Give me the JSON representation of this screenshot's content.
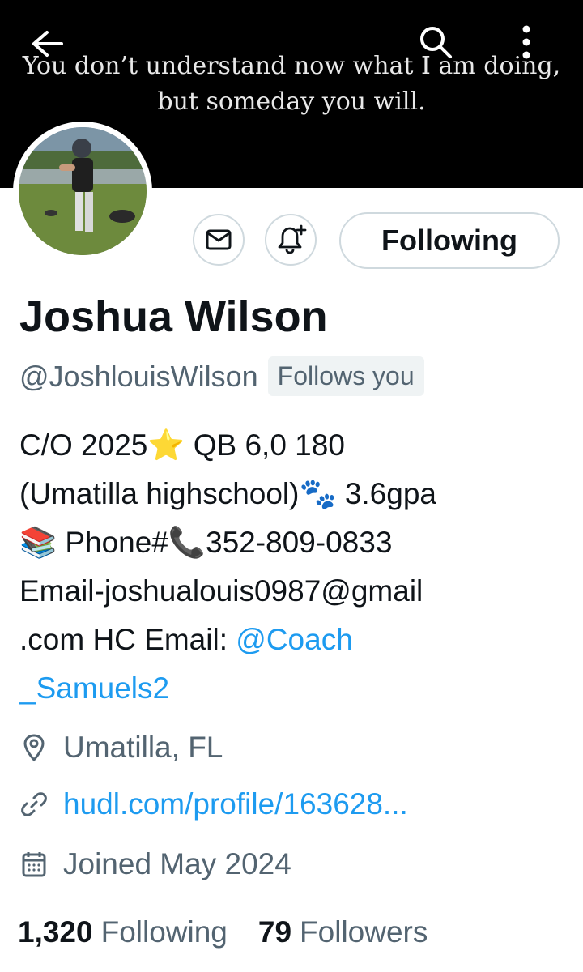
{
  "banner": {
    "quote_line1": "You don’t understand now what I am doing,",
    "quote_line2": "but someday you will."
  },
  "toolbar": {
    "back_icon": "arrow-left-icon",
    "search_icon": "search-icon",
    "more_icon": "more-vertical-icon"
  },
  "profile": {
    "display_name": "Joshua Wilson",
    "handle": "@JoshlouisWilson",
    "follows_you": "Follows you",
    "following_button": "Following",
    "bio": {
      "line1": "C/O 2025⭐ QB 6,0 180",
      "line2": "(Umatilla highschool)🐾 3.6gpa",
      "line3": "📚 Phone#📞352-809-0833",
      "line4": "Email-joshualouis0987@gmail",
      "line5_text": ".com HC Email: ",
      "line5_mention": "@Coach",
      "line6_mention": "_Samuels2"
    },
    "location": "Umatilla, FL",
    "link": "hudl.com/profile/163628...",
    "joined": "Joined May 2024",
    "following_count": "1,320",
    "following_label": "Following",
    "followers_count": "79",
    "followers_label": "Followers"
  },
  "colors": {
    "accent": "#1d9bf0",
    "secondary_text": "#536471",
    "banner_bg": "#000000"
  }
}
